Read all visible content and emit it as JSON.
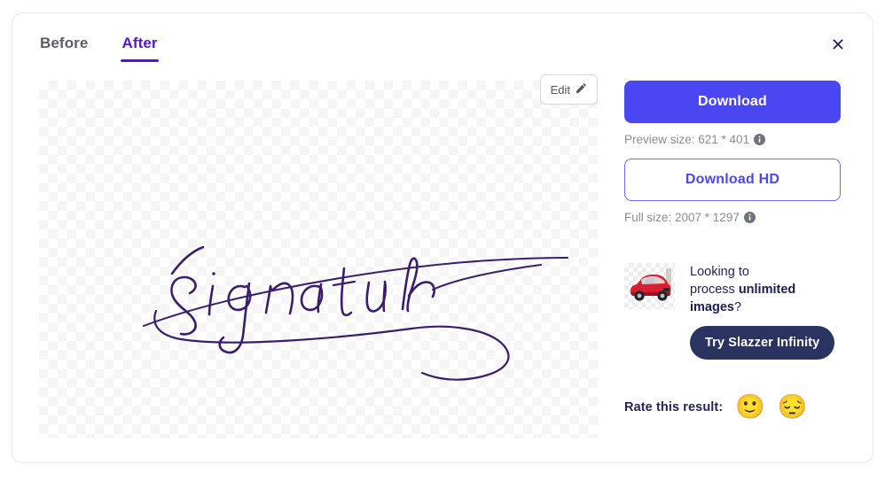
{
  "modal": {
    "tabs": [
      {
        "label": "Before",
        "active": false
      },
      {
        "label": "After",
        "active": true
      }
    ],
    "close_label": "Close",
    "close_icon": "close-icon"
  },
  "preview": {
    "edit_label": "Edit",
    "edit_icon": "pencil-icon",
    "image_alt": "Signature",
    "signature_text": "Signature",
    "ink_color": "#3a1d6e",
    "background": "transparent-checkerboard"
  },
  "actions": {
    "download_label": "Download",
    "preview_size_label": "Preview size: 621 * 401",
    "preview_info_icon": "info-icon",
    "download_hd_label": "Download HD",
    "full_size_label": "Full size: 2007 * 1297",
    "full_info_icon": "info-icon"
  },
  "promo": {
    "line1": "Looking to",
    "line2_prefix": "process ",
    "line2_bold": "unlimited",
    "line3_bold": "images",
    "line3_suffix": "?",
    "cta_label": "Try Slazzer Infinity",
    "thumb_alt": "red-car-thumbnail"
  },
  "rating": {
    "label": "Rate this result:",
    "positive_icon": "slightly-smiling-face-emoji",
    "positive_glyph": "🙂",
    "negative_icon": "pensive-face-emoji",
    "negative_glyph": "😔"
  },
  "colors": {
    "accent_blue": "#4a46f2",
    "accent_purple": "#5415d8",
    "navy": "#2b3360",
    "muted_text": "#8a8d94"
  }
}
